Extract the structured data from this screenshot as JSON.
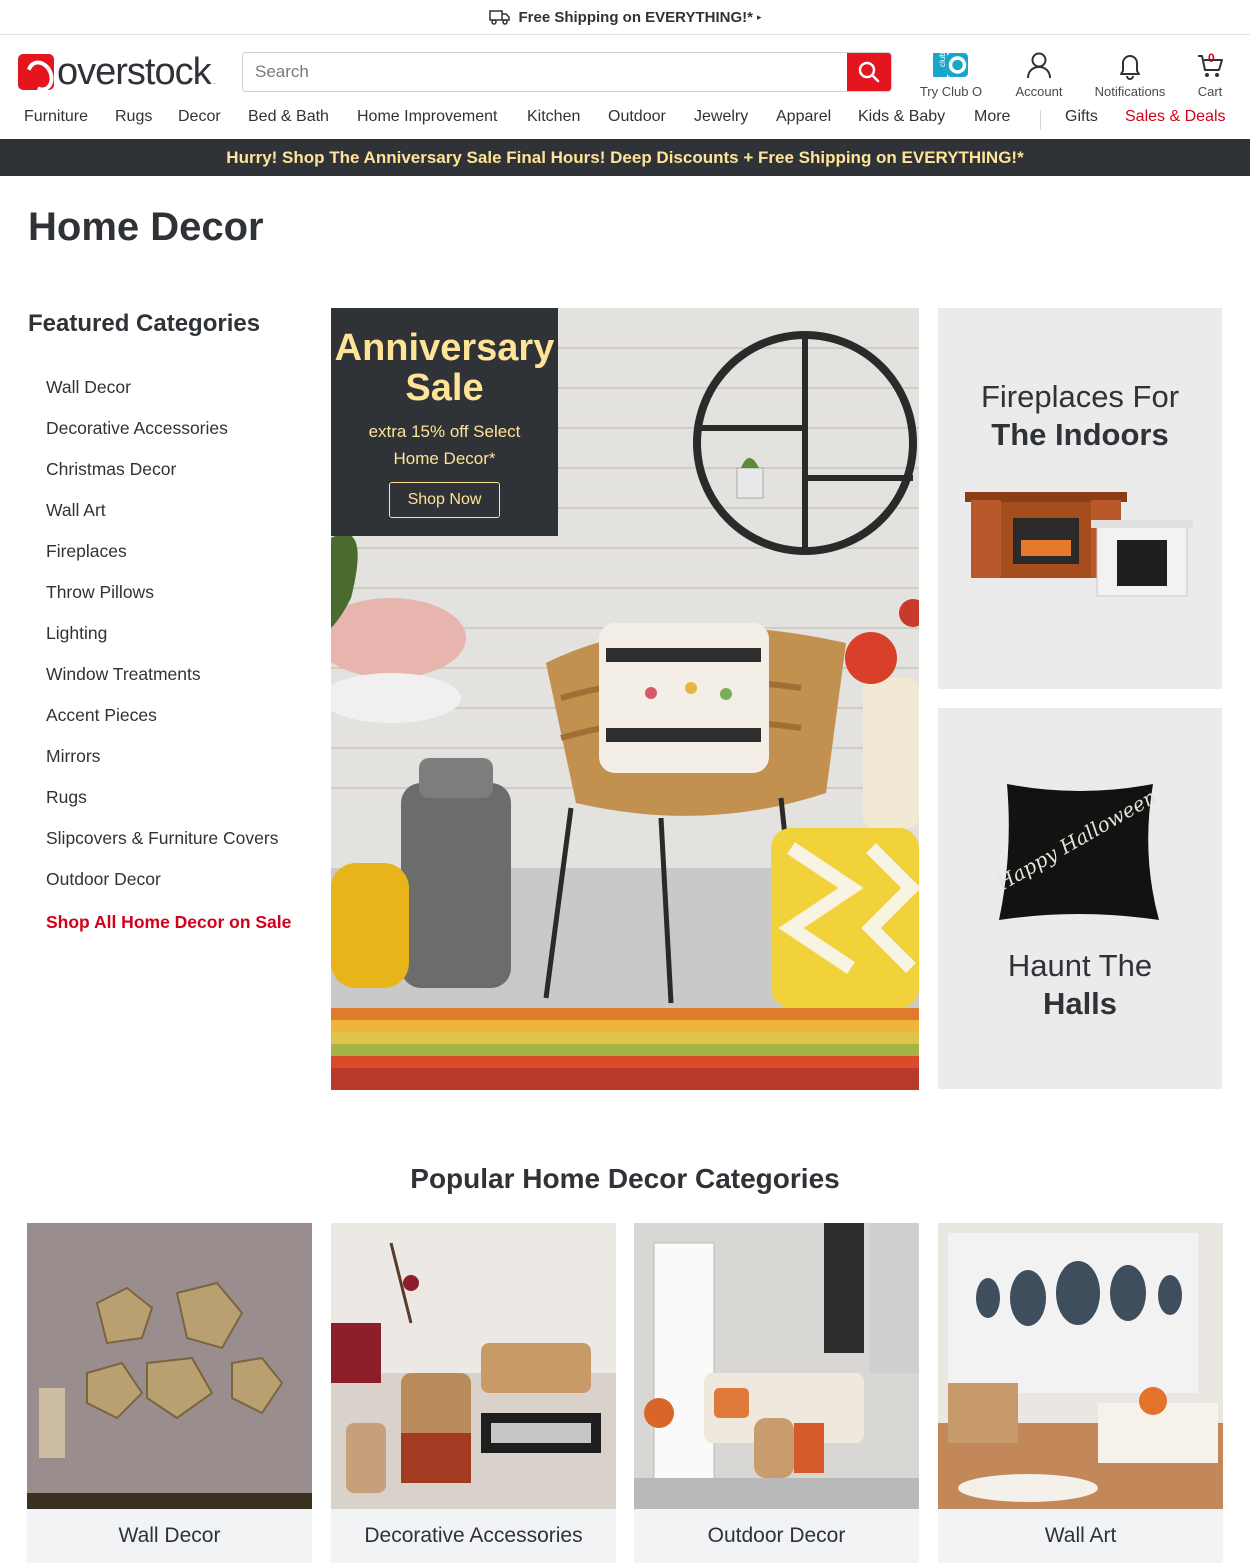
{
  "shipping_bar": {
    "text": "Free Shipping on EVERYTHING!*",
    "caret": "▸"
  },
  "header": {
    "logo_text": "overstock",
    "logo_trademark": ".",
    "search": {
      "placeholder": "Search",
      "value": ""
    },
    "icons": [
      {
        "label": "Try Club O",
        "icon": "club-o-icon"
      },
      {
        "label": "Account",
        "icon": "account-icon"
      },
      {
        "label": "Notifications",
        "icon": "bell-icon"
      },
      {
        "label": "Cart",
        "icon": "cart-icon",
        "count": "0"
      }
    ]
  },
  "nav": {
    "items": [
      "Furniture",
      "Rugs",
      "Decor",
      "Bed & Bath",
      "Home Improvement",
      "Kitchen",
      "Outdoor",
      "Jewelry",
      "Apparel",
      "Kids & Baby",
      "More",
      "Gifts",
      "Sales & Deals"
    ]
  },
  "promo_banner": "Hurry! Shop The Anniversary Sale Final Hours! Deep Discounts + Free Shipping on EVERYTHING!*",
  "page_title": "Home Decor",
  "featured": {
    "title": "Featured Categories",
    "items": [
      "Wall Decor",
      "Decorative Accessories",
      "Christmas Decor",
      "Wall Art",
      "Fireplaces",
      "Throw Pillows",
      "Lighting",
      "Window Treatments",
      "Accent Pieces",
      "Mirrors",
      "Rugs",
      "Slipcovers & Furniture Covers",
      "Outdoor Decor"
    ],
    "sale_link": "Shop All Home Decor on Sale"
  },
  "hero": {
    "title_line1": "Anniversary",
    "title_line2": "Sale",
    "subtitle_line1": "extra 15% off Select",
    "subtitle_line2": "Home Decor*",
    "button": "Shop Now"
  },
  "side_cards": [
    {
      "line1": "Fireplaces For",
      "line2": "The Indoors"
    },
    {
      "line1": "Haunt The",
      "line2": "Halls",
      "pillow_text": "Happy Halloween"
    }
  ],
  "popular": {
    "title": "Popular Home Decor Categories",
    "tiles": [
      "Wall Decor",
      "Decorative Accessories",
      "Outdoor Decor",
      "Wall Art"
    ]
  },
  "colors": {
    "brand_red": "#e5151f",
    "deals_red": "#d0021b",
    "promo_bg": "#2f3337",
    "promo_text": "#ffe396"
  }
}
